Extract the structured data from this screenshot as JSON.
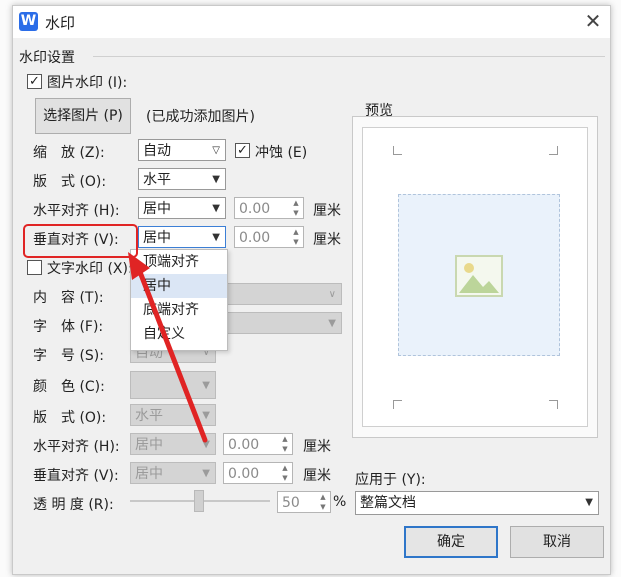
{
  "window": {
    "title": "水印",
    "logo": "W",
    "close": "✕"
  },
  "group": {
    "label": "水印设置"
  },
  "picture": {
    "checkbox_label": "图片水印 (I):",
    "checked": true,
    "select_button": "选择图片 (P)",
    "status": "(已成功添加图片)",
    "scale_label": "缩　放 (Z):",
    "scale_value": "自动",
    "washout_label": "冲蚀 (E)",
    "washout_checked": true,
    "layout_label": "版　式 (O):",
    "layout_value": "水平",
    "halign_label": "水平对齐 (H):",
    "halign_value": "居中",
    "halign_offset": "0.00",
    "valign_label": "垂直对齐 (V):",
    "valign_value": "居中",
    "valign_offset": "0.00",
    "unit": "厘米"
  },
  "valign_dropdown": {
    "options": [
      "顶端对齐",
      "居中",
      "底端对齐",
      "自定义"
    ],
    "selected_index": 1
  },
  "text": {
    "checkbox_label": "文字水印 (X):",
    "checked": false,
    "content_label": "内　容 (T):",
    "font_label": "字　体 (F):",
    "size_label": "字　号 (S):",
    "size_value": "自动",
    "color_label": "颜　色 (C):",
    "layout_label": "版　式 (O):",
    "layout_value": "水平",
    "halign_label": "水平对齐 (H):",
    "halign_value": "居中",
    "halign_offset": "0.00",
    "valign_label": "垂直对齐 (V):",
    "valign_value": "居中",
    "valign_offset": "0.00",
    "unit": "厘米",
    "transparency_label": "透 明 度 (R):",
    "transparency_value": "50",
    "transparency_unit": "%"
  },
  "preview": {
    "label": "预览"
  },
  "apply": {
    "label": "应用于 (Y):",
    "value": "整篇文档"
  },
  "buttons": {
    "ok": "确定",
    "cancel": "取消"
  },
  "colors": {
    "accent": "#2b6de8",
    "annotation": "#e02424",
    "selection": "#dbe6f5"
  },
  "icons": [
    "wps-logo-icon",
    "close-icon",
    "checkmark-icon",
    "chevron-down-icon",
    "image-placeholder-icon",
    "annotation-arrow-icon"
  ]
}
